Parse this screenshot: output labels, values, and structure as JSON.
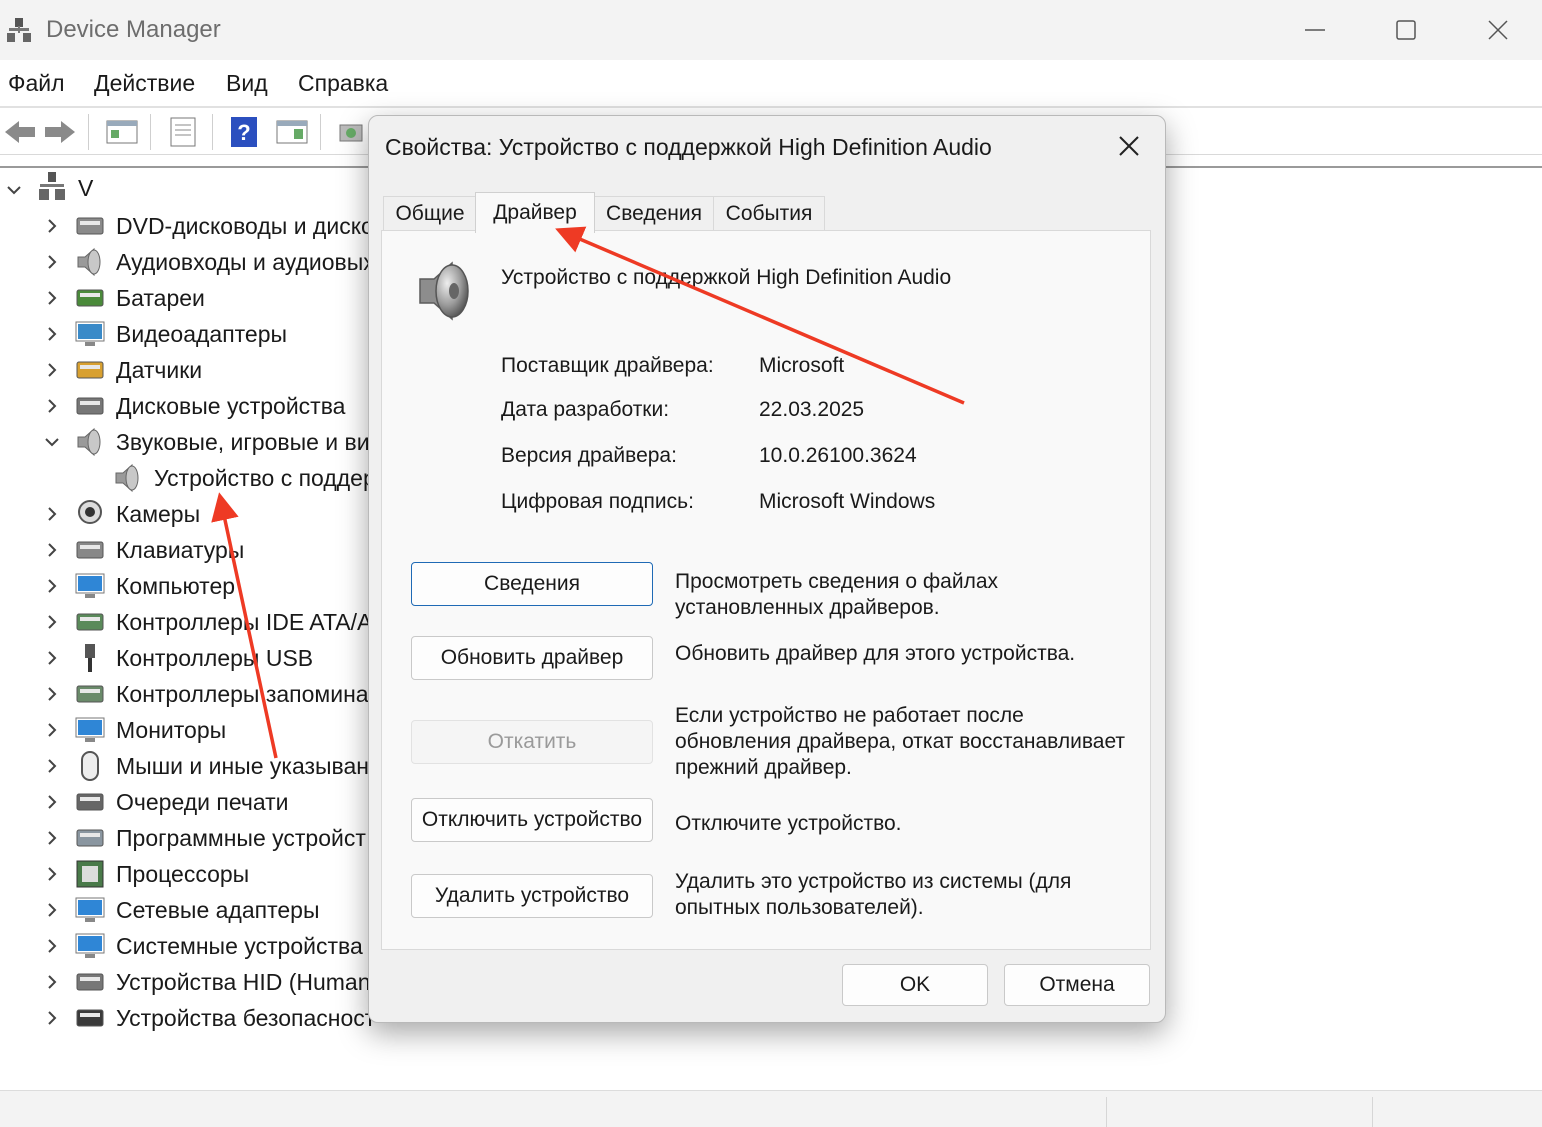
{
  "window": {
    "title": "Device Manager"
  },
  "menu": [
    "Файл",
    "Действие",
    "Вид",
    "Справка"
  ],
  "tree": {
    "root": "V",
    "items": [
      {
        "label": "DVD-дисководы и диско",
        "icon": "dvd-drive-icon"
      },
      {
        "label": "Аудиовходы и аудиовых",
        "icon": "speaker-icon"
      },
      {
        "label": "Батареи",
        "icon": "battery-icon"
      },
      {
        "label": "Видеоадаптеры",
        "icon": "display-adapter-icon"
      },
      {
        "label": "Датчики",
        "icon": "sensor-icon"
      },
      {
        "label": "Дисковые устройства",
        "icon": "disk-drive-icon"
      },
      {
        "label": "Звуковые, игровые и ви",
        "icon": "speaker-icon",
        "expanded": true
      },
      {
        "label": "Устройство с поддер",
        "icon": "speaker-icon",
        "child": true
      },
      {
        "label": "Камеры",
        "icon": "camera-icon"
      },
      {
        "label": "Клавиатуры",
        "icon": "keyboard-icon"
      },
      {
        "label": "Компьютер",
        "icon": "monitor-icon"
      },
      {
        "label": "Контроллеры IDE ATA/AT",
        "icon": "ide-controller-icon"
      },
      {
        "label": "Контроллеры USB",
        "icon": "usb-icon"
      },
      {
        "label": "Контроллеры запомина",
        "icon": "storage-controller-icon"
      },
      {
        "label": "Мониторы",
        "icon": "monitor-icon"
      },
      {
        "label": "Мыши и иные указыван",
        "icon": "mouse-icon"
      },
      {
        "label": "Очереди печати",
        "icon": "printer-icon"
      },
      {
        "label": "Программные устройст",
        "icon": "software-device-icon"
      },
      {
        "label": "Процессоры",
        "icon": "processor-icon"
      },
      {
        "label": "Сетевые адаптеры",
        "icon": "network-adapter-icon"
      },
      {
        "label": "Системные устройства",
        "icon": "system-device-icon"
      },
      {
        "label": "Устройства HID (Human",
        "icon": "hid-icon"
      },
      {
        "label": "Устройства безопасност",
        "icon": "security-device-icon"
      }
    ]
  },
  "dialog": {
    "title": "Свойства: Устройство с поддержкой High Definition Audio",
    "tabs": [
      "Общие",
      "Драйвер",
      "Сведения",
      "События"
    ],
    "active_tab": "Драйвер",
    "device_name": "Устройство с поддержкой High Definition Audio",
    "properties": [
      {
        "label": "Поставщик драйвера:",
        "value": "Microsoft"
      },
      {
        "label": "Дата разработки:",
        "value": "22.03.2025"
      },
      {
        "label": "Версия драйвера:",
        "value": "10.0.26100.3624"
      },
      {
        "label": "Цифровая подпись:",
        "value": "Microsoft Windows"
      }
    ],
    "actions": [
      {
        "label": "Сведения",
        "desc": "Просмотреть сведения о файлах установленных драйверов."
      },
      {
        "label": "Обновить драйвер",
        "desc": "Обновить драйвер для этого устройства."
      },
      {
        "label": "Откатить",
        "desc": "Если устройство не работает после обновления драйвера, откат восстанавливает прежний драйвер."
      },
      {
        "label": "Отключить устройство",
        "desc": "Отключите устройство."
      },
      {
        "label": "Удалить устройство",
        "desc": "Удалить это устройство из системы (для опытных пользователей)."
      }
    ],
    "ok": "OK",
    "cancel": "Отмена"
  },
  "colors": {
    "annotation_arrow": "#ee3a24",
    "primary_border": "#1f6ab5"
  }
}
